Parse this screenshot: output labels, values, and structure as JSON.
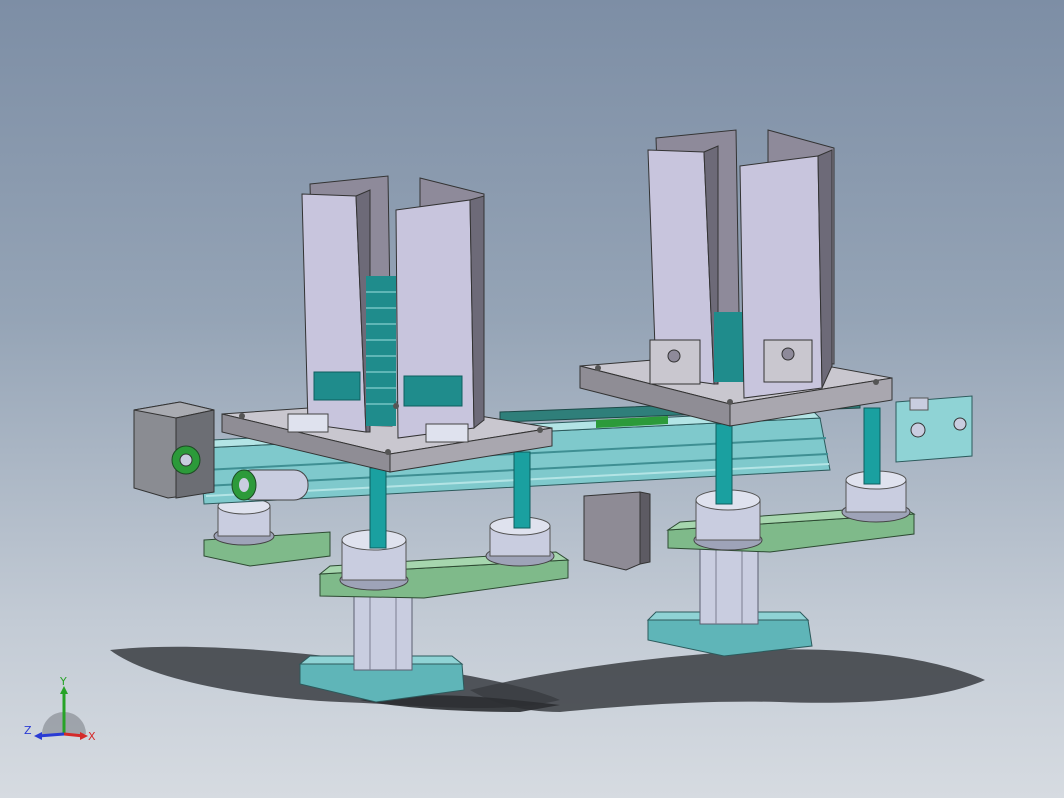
{
  "viewport": {
    "background_top": "#7d8ea5",
    "background_bottom": "#d6dbe1"
  },
  "colors": {
    "plate_top": "#c9c7cf",
    "plate_side": "#8f8d95",
    "hopper_face": "#c8c5dd",
    "hopper_side": "#8e8a9a",
    "rail": "#7fc9cc",
    "rail_dark": "#3f8f93",
    "column": "#1aa0a0",
    "base_green": "#7fba8a",
    "foot_teal": "#5fb5b8",
    "motor": "#8a8c92",
    "belt_green": "#2c9a3a",
    "cylinder": "#c9cde0",
    "shadow": "#3a3d42"
  },
  "triad": {
    "x_label": "X",
    "y_label": "Y",
    "z_label": "Z",
    "x_color": "#d42a2a",
    "y_color": "#27a327",
    "z_color": "#2a3bd4"
  }
}
